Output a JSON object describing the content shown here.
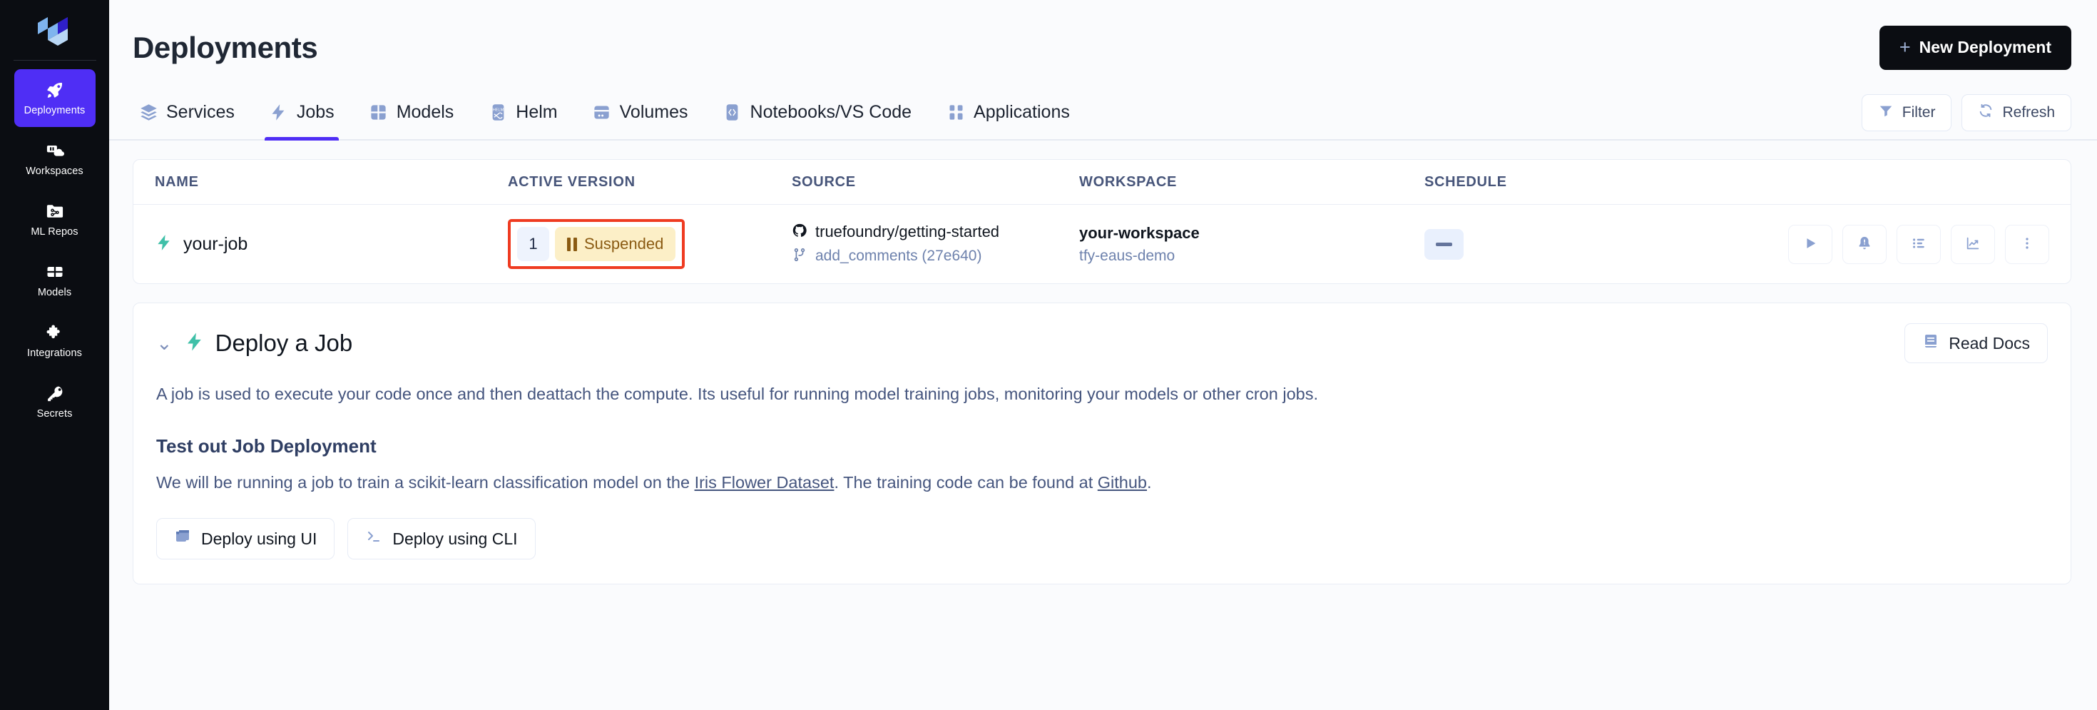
{
  "sidebar": {
    "logo_name": "truefoundry-logo",
    "items": [
      {
        "label": "Deployments",
        "icon": "rocket-icon",
        "active": true
      },
      {
        "label": "Workspaces",
        "icon": "workspaces-cloud-icon",
        "active": false
      },
      {
        "label": "ML Repos",
        "icon": "ml-repos-icon",
        "active": false
      },
      {
        "label": "Models",
        "icon": "models-grid-icon",
        "active": false
      },
      {
        "label": "Integrations",
        "icon": "puzzle-icon",
        "active": false
      },
      {
        "label": "Secrets",
        "icon": "key-icon",
        "active": false
      }
    ],
    "active_color": "#4f2ef5",
    "background": "#0b0d12"
  },
  "header": {
    "title": "Deployments",
    "new_deployment_label": "New Deployment",
    "new_deployment_plus": "+"
  },
  "tabs": {
    "items": [
      {
        "label": "Services",
        "icon": "layers-icon",
        "active": false
      },
      {
        "label": "Jobs",
        "icon": "lightning-icon",
        "active": true
      },
      {
        "label": "Models",
        "icon": "grid-icon",
        "active": false
      },
      {
        "label": "Helm",
        "icon": "helm-icon",
        "active": false
      },
      {
        "label": "Volumes",
        "icon": "volume-icon",
        "active": false
      },
      {
        "label": "Notebooks/VS Code",
        "icon": "code-brackets-icon",
        "active": false
      },
      {
        "label": "Applications",
        "icon": "apps-icon",
        "active": false
      }
    ],
    "filter_label": "Filter",
    "refresh_label": "Refresh",
    "active_indicator_color": "#4f2ef5"
  },
  "table": {
    "columns": [
      "NAME",
      "ACTIVE VERSION",
      "SOURCE",
      "WORKSPACE",
      "SCHEDULE"
    ],
    "rows": [
      {
        "name": "your-job",
        "name_icon": "lightning-icon",
        "version": "1",
        "status": "Suspended",
        "status_icon": "pause-icon",
        "highlight_color": "#ef3b21",
        "source_repo": "truefoundry/getting-started",
        "source_repo_icon": "github-icon",
        "source_branch": "add_comments (27e640)",
        "source_branch_icon": "git-branch-icon",
        "workspace": "your-workspace",
        "cluster": "tfy-eaus-demo",
        "schedule": "—",
        "actions": [
          "play-icon",
          "bell-alert-icon",
          "list-icon",
          "chart-line-icon",
          "more-vertical-icon"
        ]
      }
    ]
  },
  "deploy_panel": {
    "chevron": "⌄",
    "title": "Deploy a Job",
    "title_icon": "lightning-icon",
    "read_docs_label": "Read Docs",
    "read_docs_icon": "book-icon",
    "description": "A job is used to execute your code once and then deattach the compute. Its useful for running model training jobs, monitoring your models or other cron jobs.",
    "subtitle": "Test out Job Deployment",
    "line_prefix": "We will be running a job to train a scikit-learn classification model on the ",
    "link_dataset": "Iris Flower Dataset",
    "line_middle": ". The training code can be found at ",
    "link_github": "Github",
    "line_suffix": ".",
    "deploy_ui_label": "Deploy using UI",
    "deploy_ui_icon": "window-icon",
    "deploy_cli_label": "Deploy using CLI",
    "deploy_cli_icon": "terminal-icon"
  }
}
